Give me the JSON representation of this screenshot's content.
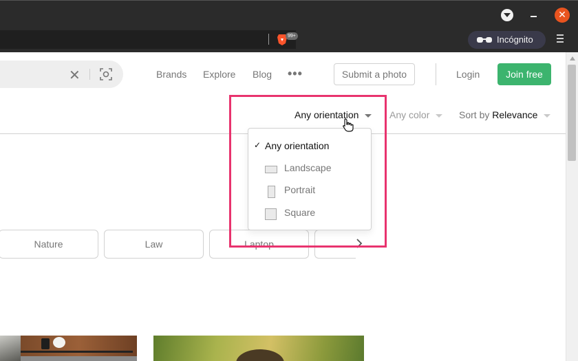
{
  "browser": {
    "tab_count_badge": "99+",
    "profile_label": "Incógnito",
    "icons": {
      "dropdown": "chevron-down-icon",
      "minimize": "minimize-icon",
      "close": "close-icon",
      "brave": "brave-lion-icon",
      "incognito": "incognito-glasses-icon",
      "menu": "hamburger-menu-icon"
    },
    "close_glyph": "✕",
    "colors": {
      "chrome": "#2b2b2b",
      "close": "#e9541f"
    }
  },
  "header": {
    "search": {
      "clear_glyph": "✕"
    },
    "nav": [
      "Brands",
      "Explore",
      "Blog"
    ],
    "more_label": "•••",
    "submit_label": "Submit a photo",
    "login_label": "Login",
    "join_label": "Join free",
    "colors": {
      "join": "#3cb46e"
    }
  },
  "filters": {
    "orientation": "Any orientation",
    "color": "Any color",
    "sort_prefix": "Sort by",
    "sort_value": "Relevance"
  },
  "orientation_menu": {
    "check_glyph": "✓",
    "items": [
      {
        "label": "Any orientation",
        "selected": true,
        "icon": "check-icon"
      },
      {
        "label": "Landscape",
        "selected": false,
        "icon": "landscape-icon"
      },
      {
        "label": "Portrait",
        "selected": false,
        "icon": "portrait-icon"
      },
      {
        "label": "Square",
        "selected": false,
        "icon": "square-icon"
      }
    ]
  },
  "related_chips": [
    "Nature",
    "Law",
    "Laptop"
  ],
  "annotation": {
    "highlight_color": "#e8336e"
  }
}
